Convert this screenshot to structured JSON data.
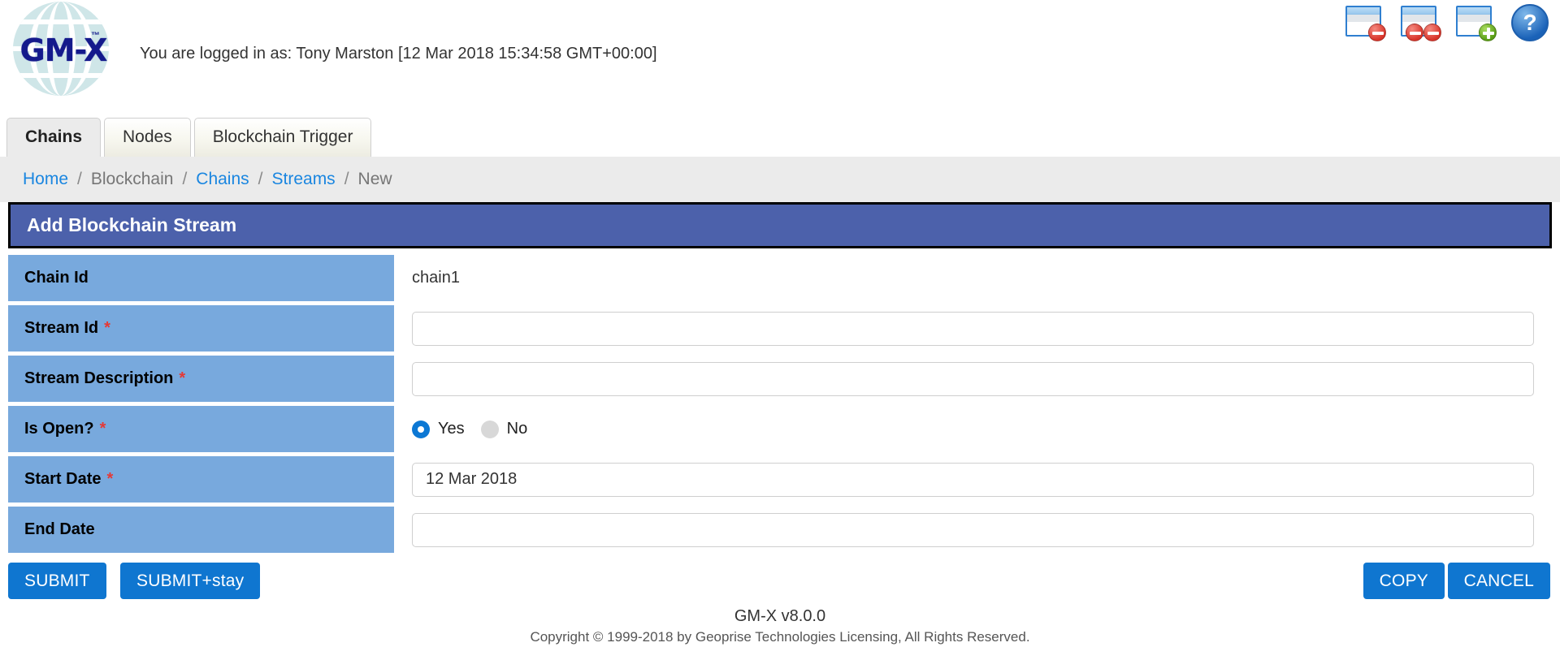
{
  "header": {
    "logo_text": "GM-X",
    "logo_tm": "™",
    "login_text": "You are logged in as: Tony Marston [12 Mar 2018 15:34:58 GMT+00:00]",
    "icons": [
      {
        "name": "close-window-icon",
        "title": "Close Window"
      },
      {
        "name": "close-all-windows-icon",
        "title": "Close All Windows"
      },
      {
        "name": "new-window-icon",
        "title": "New Window"
      },
      {
        "name": "help-icon",
        "title": "Help",
        "glyph": "?"
      }
    ]
  },
  "tabs": [
    {
      "label": "Chains",
      "active": true
    },
    {
      "label": "Nodes",
      "active": false
    },
    {
      "label": "Blockchain Trigger",
      "active": false
    }
  ],
  "breadcrumb": {
    "items": [
      {
        "label": "Home",
        "link": true
      },
      {
        "label": "Blockchain",
        "link": false
      },
      {
        "label": "Chains",
        "link": true
      },
      {
        "label": "Streams",
        "link": true
      },
      {
        "label": "New",
        "link": false
      }
    ],
    "separator": "/"
  },
  "page_title": "Add Blockchain Stream",
  "form": {
    "rows": [
      {
        "label": "Chain Id",
        "required": false,
        "type": "static",
        "value": "chain1"
      },
      {
        "label": "Stream Id",
        "required": true,
        "type": "text",
        "value": ""
      },
      {
        "label": "Stream Description",
        "required": true,
        "type": "text",
        "value": ""
      },
      {
        "label": "Is Open?",
        "required": true,
        "type": "radio",
        "value": "Yes"
      },
      {
        "label": "Start Date",
        "required": true,
        "type": "text",
        "value": "12 Mar 2018"
      },
      {
        "label": "End Date",
        "required": false,
        "type": "text",
        "value": ""
      }
    ],
    "radio_options": [
      {
        "label": "Yes",
        "selected": true
      },
      {
        "label": "No",
        "selected": false
      }
    ],
    "required_marker": "*"
  },
  "buttons": {
    "submit": "SUBMIT",
    "submit_stay": "SUBMIT+stay",
    "copy": "COPY",
    "cancel": "CANCEL"
  },
  "footer": {
    "version": "GM-X v8.0.0",
    "copyright": "Copyright © 1999-2018 by Geoprise Technologies Licensing, All Rights Reserved."
  },
  "colors": {
    "title_bar": "#4c61ab",
    "label_cell": "#78a9dd",
    "button": "#0f76d0",
    "link": "#1a86e0",
    "required": "#e53935",
    "breadcrumb_bg": "#ebebeb"
  }
}
